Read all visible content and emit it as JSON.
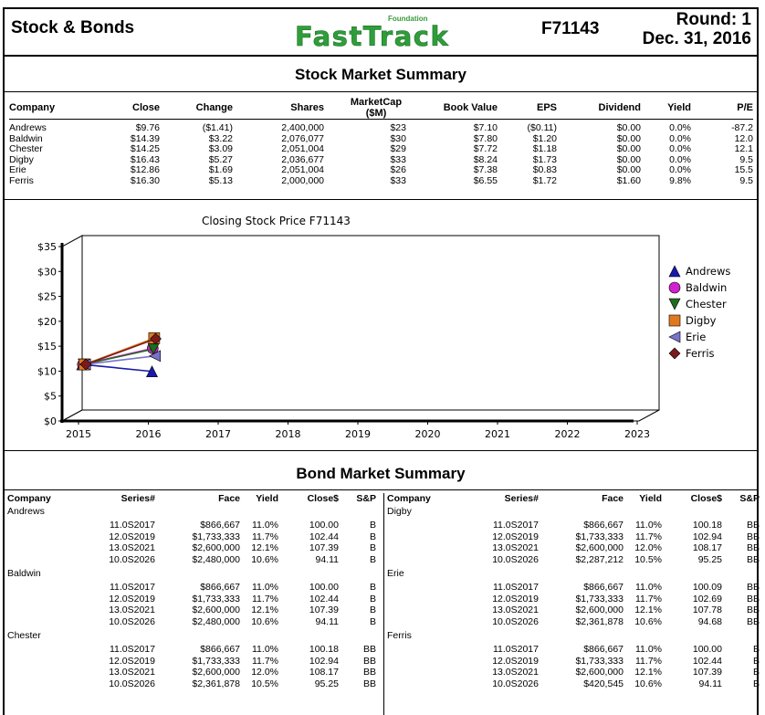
{
  "header": {
    "left_title": "Stock & Bonds",
    "logo_small": "Foundation",
    "logo_main": "FastTrack",
    "report_id": "F71143",
    "round_label": "Round: 1",
    "date": "Dec. 31, 2016"
  },
  "stock_summary": {
    "title": "Stock Market Summary",
    "columns": [
      "Company",
      "Close",
      "Change",
      "Shares",
      "MarketCap ($M)",
      "Book Value",
      "EPS",
      "Dividend",
      "Yield",
      "P/E"
    ],
    "rows": [
      [
        "Andrews",
        "$9.76",
        "($1.41)",
        "2,400,000",
        "$23",
        "$7.10",
        "($0.11)",
        "$0.00",
        "0.0%",
        "-87.2"
      ],
      [
        "Baldwin",
        "$14.39",
        "$3.22",
        "2,076,077",
        "$30",
        "$7.80",
        "$1.20",
        "$0.00",
        "0.0%",
        "12.0"
      ],
      [
        "Chester",
        "$14.25",
        "$3.09",
        "2,051,004",
        "$29",
        "$7.72",
        "$1.18",
        "$0.00",
        "0.0%",
        "12.1"
      ],
      [
        "Digby",
        "$16.43",
        "$5.27",
        "2,036,677",
        "$33",
        "$8.24",
        "$1.73",
        "$0.00",
        "0.0%",
        "9.5"
      ],
      [
        "Erie",
        "$12.86",
        "$1.69",
        "2,051,004",
        "$26",
        "$7.38",
        "$0.83",
        "$0.00",
        "0.0%",
        "15.5"
      ],
      [
        "Ferris",
        "$16.30",
        "$5.13",
        "2,000,000",
        "$33",
        "$6.55",
        "$1.72",
        "$1.60",
        "9.8%",
        "9.5"
      ]
    ]
  },
  "chart_data": {
    "type": "line",
    "title": "Closing Stock Price  F71143",
    "x": [
      "2015",
      "2016",
      "2017",
      "2018",
      "2019",
      "2020",
      "2021",
      "2022",
      "2023"
    ],
    "ylim": [
      0,
      35
    ],
    "y_ticks": [
      "$0",
      "$5",
      "$10",
      "$15",
      "$20",
      "$25",
      "$30",
      "$35"
    ],
    "grid": false,
    "legend_position": "right",
    "series": [
      {
        "name": "Andrews",
        "values": [
          11.17,
          9.76
        ],
        "color": "#1a1aa8",
        "marker": "triangle-up"
      },
      {
        "name": "Baldwin",
        "values": [
          11.17,
          14.39
        ],
        "color": "#d020d0",
        "marker": "circle"
      },
      {
        "name": "Chester",
        "values": [
          11.16,
          14.25
        ],
        "color": "#1f6b1f",
        "marker": "triangle-down"
      },
      {
        "name": "Digby",
        "values": [
          11.16,
          16.43
        ],
        "color": "#e07820",
        "marker": "square"
      },
      {
        "name": "Erie",
        "values": [
          11.17,
          12.86
        ],
        "color": "#7a72c8",
        "marker": "triangle-left"
      },
      {
        "name": "Ferris",
        "values": [
          11.17,
          16.3
        ],
        "color": "#7a1a1a",
        "marker": "diamond"
      }
    ]
  },
  "bond_summary": {
    "title": "Bond Market Summary",
    "columns": [
      "Company",
      "Series#",
      "Face",
      "Yield",
      "Close$",
      "S&P"
    ],
    "left": [
      {
        "company": "Andrews",
        "bonds": [
          [
            "11.0S2017",
            "$866,667",
            "11.0%",
            "100.00",
            "B"
          ],
          [
            "12.0S2019",
            "$1,733,333",
            "11.7%",
            "102.44",
            "B"
          ],
          [
            "13.0S2021",
            "$2,600,000",
            "12.1%",
            "107.39",
            "B"
          ],
          [
            "10.0S2026",
            "$2,480,000",
            "10.6%",
            "94.11",
            "B"
          ]
        ]
      },
      {
        "company": "Baldwin",
        "bonds": [
          [
            "11.0S2017",
            "$866,667",
            "11.0%",
            "100.00",
            "B"
          ],
          [
            "12.0S2019",
            "$1,733,333",
            "11.7%",
            "102.44",
            "B"
          ],
          [
            "13.0S2021",
            "$2,600,000",
            "12.1%",
            "107.39",
            "B"
          ],
          [
            "10.0S2026",
            "$2,480,000",
            "10.6%",
            "94.11",
            "B"
          ]
        ]
      },
      {
        "company": "Chester",
        "bonds": [
          [
            "11.0S2017",
            "$866,667",
            "11.0%",
            "100.18",
            "BB"
          ],
          [
            "12.0S2019",
            "$1,733,333",
            "11.7%",
            "102.94",
            "BB"
          ],
          [
            "13.0S2021",
            "$2,600,000",
            "12.0%",
            "108.17",
            "BB"
          ],
          [
            "10.0S2026",
            "$2,361,878",
            "10.5%",
            "95.25",
            "BB"
          ]
        ]
      }
    ],
    "right": [
      {
        "company": "Digby",
        "bonds": [
          [
            "11.0S2017",
            "$866,667",
            "11.0%",
            "100.18",
            "BB"
          ],
          [
            "12.0S2019",
            "$1,733,333",
            "11.7%",
            "102.94",
            "BB"
          ],
          [
            "13.0S2021",
            "$2,600,000",
            "12.0%",
            "108.17",
            "BB"
          ],
          [
            "10.0S2026",
            "$2,287,212",
            "10.5%",
            "95.25",
            "BB"
          ]
        ]
      },
      {
        "company": "Erie",
        "bonds": [
          [
            "11.0S2017",
            "$866,667",
            "11.0%",
            "100.09",
            "BB"
          ],
          [
            "12.0S2019",
            "$1,733,333",
            "11.7%",
            "102.69",
            "BB"
          ],
          [
            "13.0S2021",
            "$2,600,000",
            "12.1%",
            "107.78",
            "BB"
          ],
          [
            "10.0S2026",
            "$2,361,878",
            "10.6%",
            "94.68",
            "BB"
          ]
        ]
      },
      {
        "company": "Ferris",
        "bonds": [
          [
            "11.0S2017",
            "$866,667",
            "11.0%",
            "100.00",
            "B"
          ],
          [
            "12.0S2019",
            "$1,733,333",
            "11.7%",
            "102.44",
            "B"
          ],
          [
            "13.0S2021",
            "$2,600,000",
            "12.1%",
            "107.39",
            "B"
          ],
          [
            "10.0S2026",
            "$420,545",
            "10.6%",
            "94.11",
            "B"
          ]
        ]
      }
    ]
  }
}
